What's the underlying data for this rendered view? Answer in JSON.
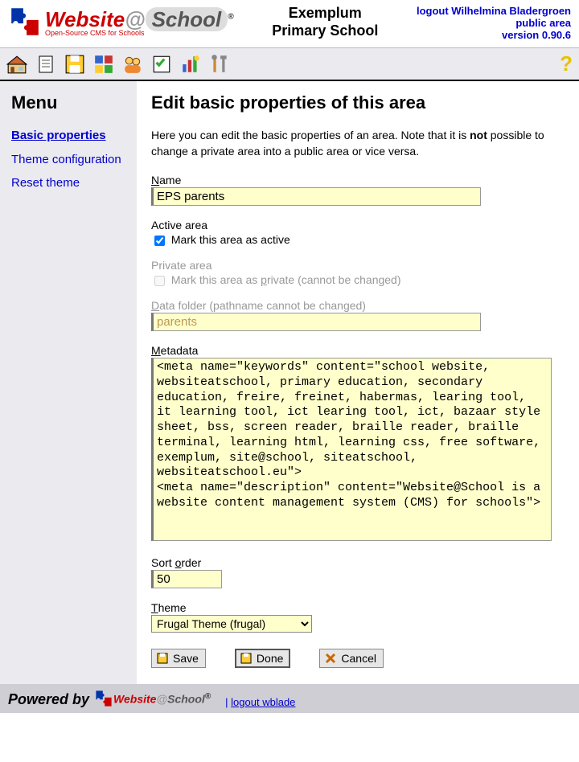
{
  "header": {
    "school_line1": "Exemplum",
    "school_line2": "Primary School",
    "logout_text": "logout Wilhelmina Bladergroen",
    "public_area": "public area",
    "version": "version 0.90.6"
  },
  "sidebar": {
    "title": "Menu",
    "items": [
      {
        "label": "Basic properties",
        "active": true
      },
      {
        "label": "Theme configuration",
        "active": false
      },
      {
        "label": "Reset theme",
        "active": false
      }
    ]
  },
  "content": {
    "title": "Edit basic properties of this area",
    "intro_before": "Here you can edit the basic properties of an area. Note that it is ",
    "intro_bold": "not",
    "intro_after": " possible to change a private area into a public area or vice versa.",
    "name_label_pre": "N",
    "name_label_rest": "ame",
    "name_value": "EPS parents",
    "active_label": "Active area",
    "active_checkbox_pre": "Mark this area as ",
    "active_checkbox_ul": "a",
    "active_checkbox_rest": "ctive",
    "private_label": "Private area",
    "private_checkbox_pre": "Mark this area as ",
    "private_checkbox_ul": "p",
    "private_checkbox_rest": "rivate (cannot be changed)",
    "datafolder_label_pre": "D",
    "datafolder_label_rest": "ata folder (pathname cannot be changed)",
    "datafolder_value": "parents",
    "metadata_label_pre": "M",
    "metadata_label_rest": "etadata",
    "metadata_value": "<meta name=\"keywords\" content=\"school website, websiteatschool, primary education, secondary education, freire, freinet, habermas, learing tool, it learning tool, ict learing tool, ict, bazaar style sheet, bss, screen reader, braille reader, braille terminal, learning html, learning css, free software, exemplum, site@school, siteatschool, websiteatschool.eu\">\n<meta name=\"description\" content=\"Website@School is a website content management system (CMS) for schools\">",
    "sortorder_label_pre": "Sort ",
    "sortorder_label_ul": "o",
    "sortorder_label_rest": "rder",
    "sortorder_value": "50",
    "theme_label_pre": "T",
    "theme_label_rest": "heme",
    "theme_value": "Frugal Theme (frugal)",
    "save_label": "Save",
    "done_label": "Done",
    "cancel_label": "Cancel"
  },
  "footer": {
    "powered": "Powered by",
    "logout_sep": "| ",
    "logout_link": "logout wblade"
  },
  "toolbar_icons": [
    "home",
    "page",
    "disk",
    "modules",
    "users",
    "checklist",
    "stats",
    "tools"
  ]
}
